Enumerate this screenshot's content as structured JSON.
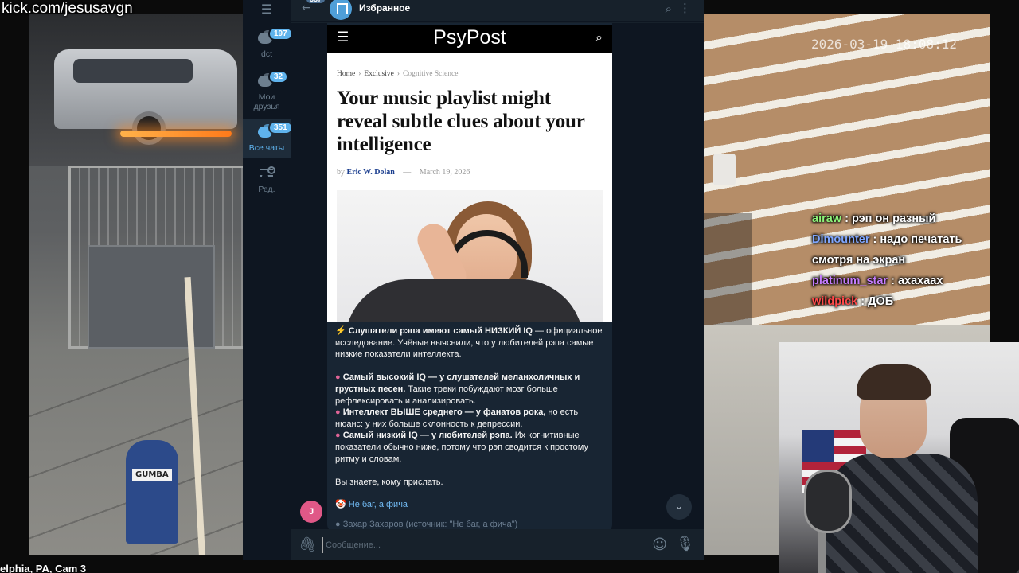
{
  "stream": {
    "channel_url": "kick.com/jesusavgn",
    "cam_caption": "elphia, PA, Cam 3",
    "wall_timestamp": "2026-03-19 18:08:12"
  },
  "stream_chat": [
    {
      "user": "airaw",
      "user_color": "#8ef57a",
      "message": "рэп он разный"
    },
    {
      "user": "Dimounter",
      "user_color": "#7fa6ff",
      "message": "надо печатать смотря на экран"
    },
    {
      "user": "platinum_star",
      "user_color": "#c57cff",
      "message": "ахахаах"
    },
    {
      "user": "wildpick",
      "user_color": "#ff4a4a",
      "message": "ДОБ"
    }
  ],
  "telegram": {
    "folders": [
      {
        "label": "dct",
        "badge": "197",
        "icon": "chat-folder-icon"
      },
      {
        "label": "Мои друзья",
        "badge": "32",
        "icon": "chat-folder-icon"
      },
      {
        "label": "Все чаты",
        "badge": "351",
        "icon": "chats-icon",
        "active": true
      },
      {
        "label": "Ред.",
        "badge": "",
        "icon": "sliders-icon"
      }
    ],
    "header": {
      "back_badge": "357",
      "title": "Избранное"
    },
    "article": {
      "site": "PsyPost",
      "crumbs": [
        "Home",
        "Exclusive",
        "Cognitive Science"
      ],
      "headline": "Your music playlist might reveal subtle clues about your intelligence",
      "by": "by",
      "author": "Eric W. Dolan",
      "date": "March 19, 2026"
    },
    "message": {
      "intro_bold": "Слушатели рэпа имеют самый НИЗКИЙ IQ",
      "intro_rest": " — официальное исследование. Учёные выяснили, что у любителей рэпа самые низкие показатели интеллекта.",
      "b1_bold": "Самый высокий IQ — у слушателей меланхоличных и грустных песен.",
      "b1_rest": " Такие треки побуждают мозг больше рефлексировать и анализировать.",
      "b2_bold": "Интеллект ВЫШЕ среднего — у фанатов рока,",
      "b2_rest": " но есть нюанс: у них больше склонность к депрессии.",
      "b3_bold": "Самый низкий IQ — у любителей рэпа.",
      "b3_rest": " Их когнитивные показатели обычно ниже, потому что рэп сводится к простому ритму и словам.",
      "outro": "Вы знаете, кому прислать.",
      "link": "Не баг, а фича",
      "reply_preview": "Захар Захаров (источник: \"Не баг, а фича\")"
    },
    "sender_avatar_letter": "J",
    "composer": {
      "placeholder": "Сообщение..."
    }
  }
}
